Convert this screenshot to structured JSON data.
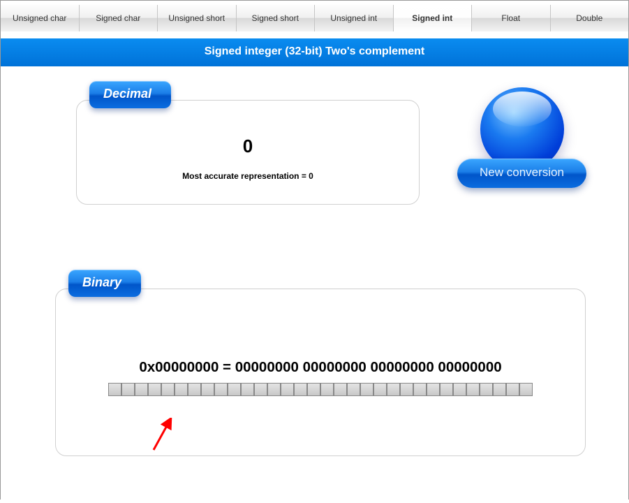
{
  "tabs": [
    {
      "label": "Unsigned char"
    },
    {
      "label": "Signed char"
    },
    {
      "label": "Unsigned short"
    },
    {
      "label": "Signed short"
    },
    {
      "label": "Unsigned int"
    },
    {
      "label": "Signed int",
      "active": true
    },
    {
      "label": "Float"
    },
    {
      "label": "Double"
    }
  ],
  "title": "Signed integer (32-bit) Two's complement",
  "decimal": {
    "badge": "Decimal",
    "value": "0",
    "accurate": "Most accurate representation = 0"
  },
  "newconv": {
    "label": "New conversion"
  },
  "binary": {
    "badge": "Binary",
    "text": "0x00000000 = 00000000 00000000 00000000 00000000",
    "bit_count": 32
  }
}
